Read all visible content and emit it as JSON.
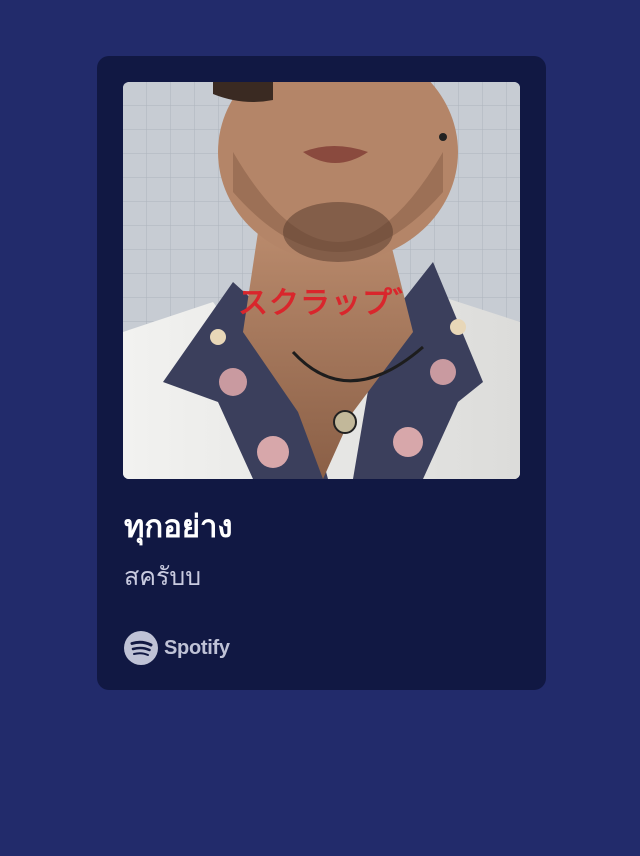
{
  "card": {
    "title": "ทุกอย่าง",
    "artist": "สครับบ",
    "cover_text": "スクラップ゛",
    "brand": "Spotify",
    "brand_icon": "spotify-logo-icon"
  },
  "colors": {
    "page_background": "#222b6b",
    "card_background": "#111843",
    "title": "#ffffff",
    "artist": "#c9cbe0",
    "brand": "#bfc2d6",
    "cover_text": "#d9262c"
  }
}
